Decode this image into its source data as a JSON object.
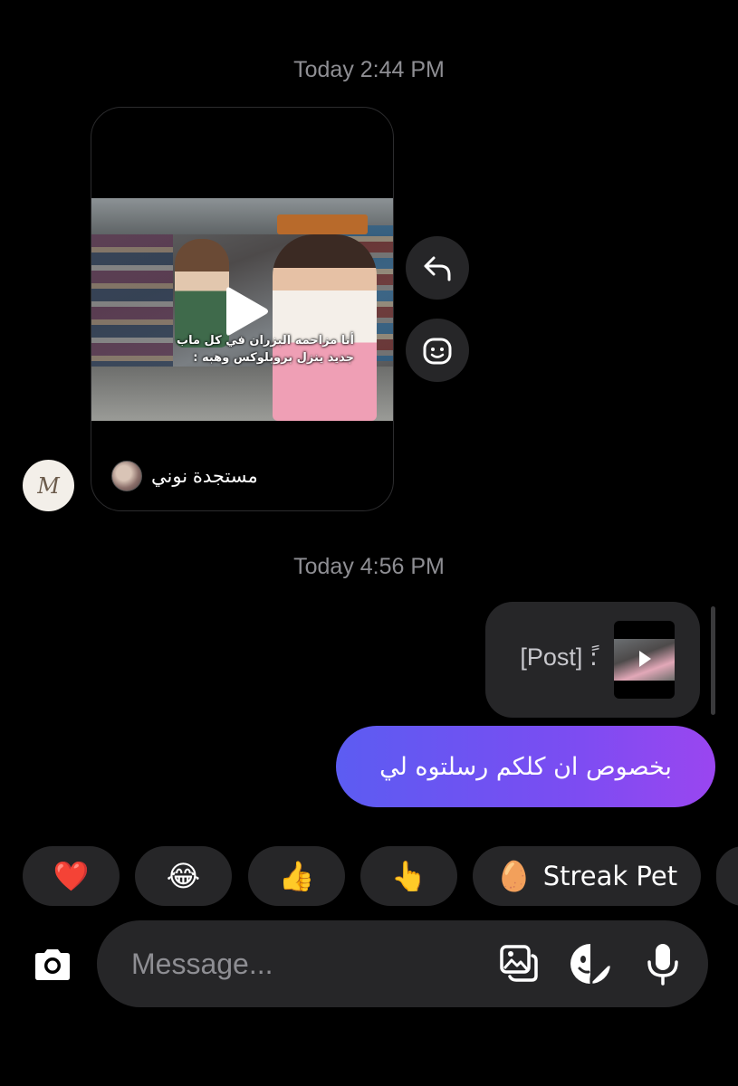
{
  "thread": {
    "timestamp_1": "Today 2:44 PM",
    "timestamp_2": "Today 4:56 PM"
  },
  "reel": {
    "caption_line_1": "أنا مزاحمه البزران في كل ماب",
    "caption_line_2": "جديد ينزل بروبلوكس وهبه :",
    "author": "مستجدة نوني",
    "icon_play": "play-icon",
    "icon_reply": "reply-icon",
    "icon_react": "smiley-icon"
  },
  "sender": {
    "avatar_initial": "M"
  },
  "outgoing": {
    "post_label": "[Post] :ً",
    "message": "بخصوص ان كلكم رسلتوه لي"
  },
  "reactions": [
    {
      "emoji": "❤️"
    },
    {
      "emoji": "😂"
    },
    {
      "emoji": "👍"
    },
    {
      "emoji": "👆"
    },
    {
      "emoji": "🥚",
      "label": "Streak Pet"
    }
  ],
  "composer": {
    "placeholder": "Message...",
    "icons": [
      "camera-icon",
      "gallery-icon",
      "sticker-icon",
      "microphone-icon"
    ]
  },
  "colors": {
    "background": "#000000",
    "surface": "#262628",
    "bubble_gradient_start": "#5c5cf2",
    "bubble_gradient_end": "#9a46f0",
    "muted_text": "#8e8e93"
  }
}
